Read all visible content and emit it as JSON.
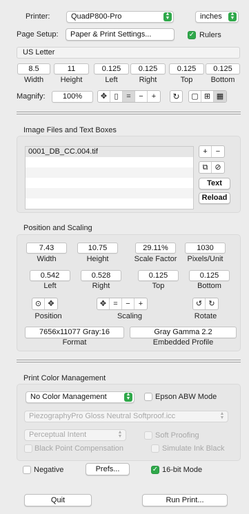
{
  "top": {
    "printer_label": "Printer:",
    "printer_value": "QuadP800-Pro",
    "units_value": "inches",
    "page_setup_label": "Page Setup:",
    "page_setup_button": "Paper & Print Settings...",
    "rulers_label": "Rulers",
    "paper_name": "US Letter"
  },
  "paper": {
    "values": [
      "8.5",
      "11",
      "0.125",
      "0.125",
      "0.125",
      "0.125"
    ],
    "labels": [
      "Width",
      "Height",
      "Left",
      "Right",
      "Top",
      "Bottom"
    ]
  },
  "magnify": {
    "label": "Magnify:",
    "value": "100%"
  },
  "images": {
    "title": "Image Files and Text Boxes",
    "files": [
      "0001_DB_CC.004.tif",
      "",
      "",
      "",
      "",
      ""
    ],
    "text_button": "Text",
    "reload_button": "Reload"
  },
  "position": {
    "title": "Position and Scaling",
    "row1_values": [
      "7.43",
      "10.75",
      "29.11%",
      "1030"
    ],
    "row1_labels": [
      "Width",
      "Height",
      "Scale Factor",
      "Pixels/Unit"
    ],
    "row2_values": [
      "0.542",
      "0.528",
      "0.125",
      "0.125"
    ],
    "row2_labels": [
      "Left",
      "Right",
      "Top",
      "Bottom"
    ],
    "position_label": "Position",
    "scaling_label": "Scaling",
    "rotate_label": "Rotate",
    "format_value": "7656x11077 Gray:16",
    "format_label": "Format",
    "profile_value": "Gray Gamma 2.2",
    "profile_label": "Embedded Profile"
  },
  "color": {
    "title": "Print Color Management",
    "mode_value": "No Color Management",
    "epson_abw_label": "Epson ABW Mode",
    "profile_value": "PiezographyPro Gloss Neutral Softproof.icc",
    "intent_value": "Perceptual Intent",
    "soft_proofing_label": "Soft Proofing",
    "bpc_label": "Black Point Compensation",
    "simulate_ink_label": "Simulate Ink Black"
  },
  "bottom": {
    "negative_label": "Negative",
    "prefs_button": "Prefs...",
    "bit16_label": "16-bit Mode",
    "quit_button": "Quit",
    "run_button": "Run Print..."
  },
  "colors": {
    "accent": "#2fa84a",
    "background": "#ececec"
  }
}
